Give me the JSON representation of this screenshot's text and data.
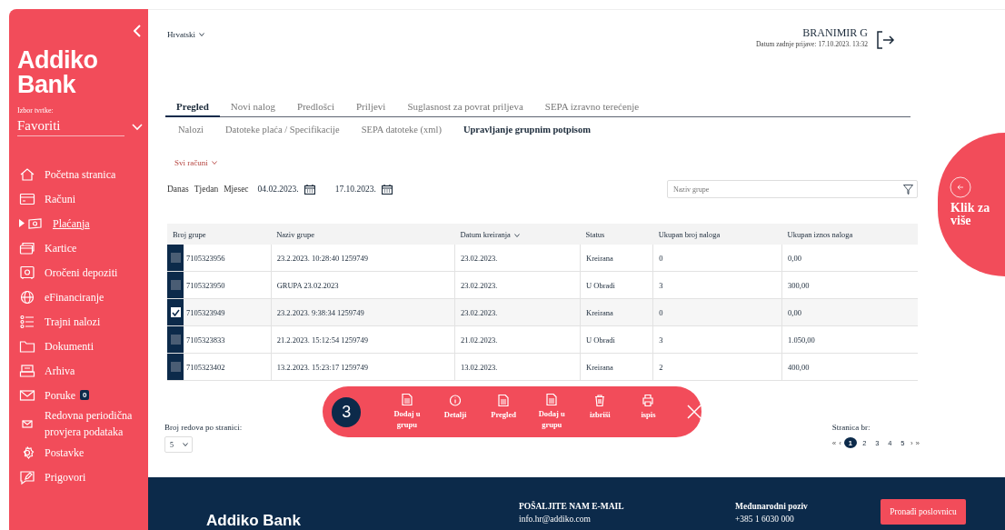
{
  "sidebar": {
    "logo": "Addiko Bank",
    "company_label": "Izbor tvrtke:",
    "company_value": "Favoriti",
    "items": [
      {
        "label": "Početna stranica",
        "selected": false
      },
      {
        "label": "Računi",
        "selected": false
      },
      {
        "label": "Plaćanja",
        "selected": true
      },
      {
        "label": "Kartice",
        "selected": false
      },
      {
        "label": "Oročeni depoziti",
        "selected": false
      },
      {
        "label": "eFinanciranje",
        "selected": false
      },
      {
        "label": "Trajni nalozi",
        "selected": false
      },
      {
        "label": "Dokumenti",
        "selected": false
      },
      {
        "label": "Arhiva",
        "selected": false
      },
      {
        "label": "Poruke",
        "selected": false,
        "badge": "0"
      },
      {
        "label": "Redovna periodična provjera podataka",
        "selected": false
      },
      {
        "label": "Postavke",
        "selected": false
      },
      {
        "label": "Prigovori",
        "selected": false
      }
    ]
  },
  "header": {
    "language": "Hrvatski",
    "user": "BRANIMIR G",
    "last_login": "Datum zadnje prijave: 17.10.2023. 13:32"
  },
  "tabs": [
    {
      "label": "Pregled",
      "selected": true
    },
    {
      "label": "Novi nalog",
      "selected": false
    },
    {
      "label": "Predlošci",
      "selected": false
    },
    {
      "label": "Priljevi",
      "selected": false
    },
    {
      "label": "Suglasnost za povrat priljeva",
      "selected": false
    },
    {
      "label": "SEPA izravno terećenje",
      "selected": false
    }
  ],
  "subtabs": [
    {
      "label": "Nalozi",
      "selected": false
    },
    {
      "label": "Datoteke plaća / Specifikacije",
      "selected": false
    },
    {
      "label": "SEPA datoteke (xml)",
      "selected": false
    },
    {
      "label": "Upravljanje grupnim potpisom",
      "selected": true
    }
  ],
  "account_filter": "Svi računi",
  "periods": [
    {
      "label": "Danas",
      "selected": false
    },
    {
      "label": "Tjedan",
      "selected": false
    },
    {
      "label": "Mjesec",
      "selected": false
    }
  ],
  "date_from": "04.02.2023.",
  "date_to": "17.10.2023.",
  "search": {
    "placeholder": "Naziv grupe"
  },
  "table": {
    "columns": [
      {
        "label": "Broj grupe",
        "sorted": false
      },
      {
        "label": "Naziv grupe",
        "sorted": false
      },
      {
        "label": "Datum kreiranja",
        "sorted": true
      },
      {
        "label": "Status",
        "sorted": false
      },
      {
        "label": "Ukupan broj naloga",
        "sorted": false
      },
      {
        "label": "Ukupan iznos naloga",
        "sorted": false
      }
    ],
    "rows": [
      {
        "checked": false,
        "cells": [
          "7105323956",
          "23.2.2023. 10:28:40 1259749",
          "23.02.2023.",
          "Kreirana",
          "0",
          "0,00"
        ]
      },
      {
        "checked": false,
        "cells": [
          "7105323950",
          "GRUPA 23.02.2023",
          "23.02.2023.",
          "U Obradi",
          "3",
          "300,00"
        ]
      },
      {
        "checked": true,
        "cells": [
          "7105323949",
          "23.2.2023. 9:38:34 1259749",
          "23.02.2023.",
          "Kreirana",
          "0",
          "0,00"
        ]
      },
      {
        "checked": false,
        "cells": [
          "7105323833",
          "21.2.2023. 15:12:54 1259749",
          "21.02.2023.",
          "U Obradi",
          "3",
          "1.050,00"
        ]
      },
      {
        "checked": false,
        "cells": [
          "7105323402",
          "13.2.2023. 15:23:17 1259749",
          "13.02.2023.",
          "Kreirana",
          "2",
          "400,00"
        ]
      }
    ]
  },
  "action_bar": {
    "count": "3",
    "actions": [
      {
        "kind": "doc",
        "label": "Dodaj u grupu"
      },
      {
        "kind": "info",
        "label": "Detalji"
      },
      {
        "kind": "doc",
        "label": "Pregled"
      },
      {
        "kind": "doc",
        "label": "Dodaj u grupu"
      },
      {
        "kind": "trash",
        "label": "izbriši"
      },
      {
        "kind": "print",
        "label": "ispis"
      }
    ]
  },
  "rows_per_page": {
    "label": "Broj redova po stranici:",
    "value": "5"
  },
  "pagination": {
    "label": "Stranica br:",
    "first": "«",
    "prev": "‹",
    "next": "›",
    "last": "»",
    "pages": [
      {
        "label": "1",
        "selected": true
      },
      {
        "label": "2",
        "selected": false
      },
      {
        "label": "3",
        "selected": false
      },
      {
        "label": "4",
        "selected": false
      },
      {
        "label": "5",
        "selected": false
      }
    ]
  },
  "more_panel": {
    "label": "Klik za više"
  },
  "footer": {
    "logo": "Addiko Bank",
    "email_heading": "POŠALJITE NAM E-MAIL",
    "email": "info.hr@addiko.com",
    "phone_heading": "Međunarodni poziv",
    "phone": "+385 1 6030 000",
    "button": "Pronađi poslovnicu"
  }
}
